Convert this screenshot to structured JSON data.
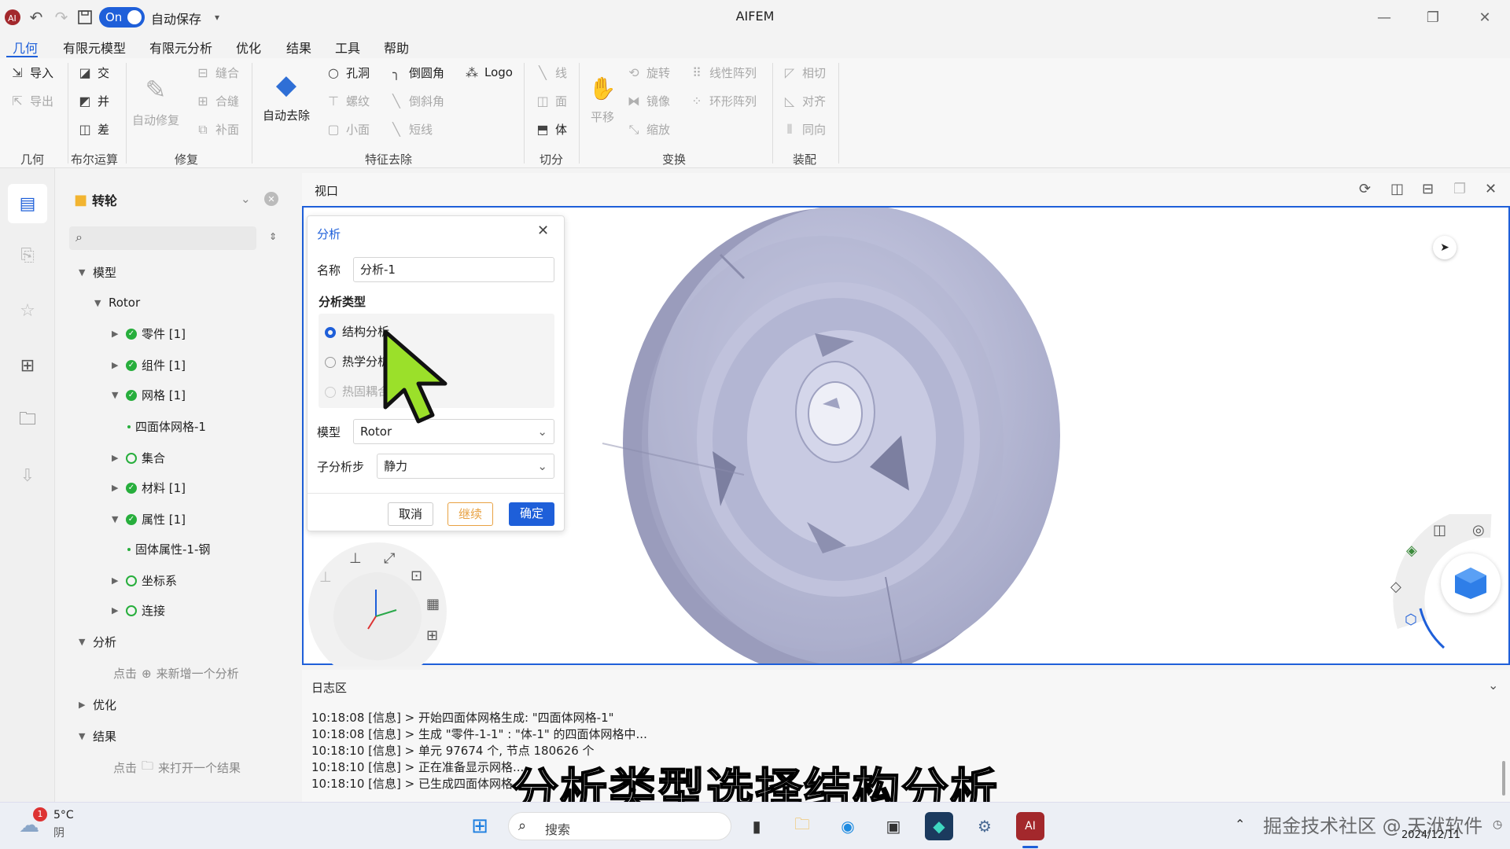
{
  "app": {
    "title": "AIFEM",
    "toggle_label": "On",
    "autosave_label": "自动保存"
  },
  "menu": [
    "几何",
    "有限元模型",
    "有限元分析",
    "优化",
    "结果",
    "工具",
    "帮助"
  ],
  "ribbon": {
    "geometry": {
      "import": "导入",
      "export": "导出",
      "label": "几何"
    },
    "boolean": {
      "intersect": "交",
      "union": "并",
      "subtract": "差",
      "label": "布尔运算"
    },
    "repair": {
      "auto_repair": "自动修复",
      "sew": "缝合",
      "merge_face": "合缝",
      "patch": "补面",
      "label": "修复"
    },
    "feature": {
      "auto_remove": "自动去除",
      "hole": "孔洞",
      "thread": "螺纹",
      "small_face": "小面",
      "fillet": "倒圆角",
      "chamfer": "倒斜角",
      "short_edge": "短线",
      "logo": "Logo",
      "label": "特征去除"
    },
    "split": {
      "line": "线",
      "face": "面",
      "body": "体",
      "label": "切分"
    },
    "transform": {
      "translate": "平移",
      "rotate": "旋转",
      "mirror": "镜像",
      "scale": "缩放",
      "linear_array": "线性阵列",
      "circular_array": "环形阵列",
      "label": "变换"
    },
    "assembly": {
      "tangent": "相切",
      "align": "对齐",
      "same_dir": "同向",
      "label": "装配"
    }
  },
  "tree": {
    "root": "转轮",
    "search_placeholder": "",
    "model": "模型",
    "rotor": "Rotor",
    "part": "零件 [1]",
    "component": "组件 [1]",
    "mesh": "网格 [1]",
    "tet_mesh": "四面体网格-1",
    "set": "集合",
    "material": "材料 [1]",
    "property": "属性 [1]",
    "solid_prop": "固体属性-1-钢",
    "csys": "坐标系",
    "connection": "连接",
    "analysis": "分析",
    "analysis_hint_pre": "点击",
    "analysis_hint_post": "来新增一个分析",
    "optimize": "优化",
    "result": "结果",
    "result_hint_pre": "点击",
    "result_hint_post": "来打开一个结果"
  },
  "viewport": {
    "title": "视口"
  },
  "dialog": {
    "title": "分析",
    "name_label": "名称",
    "name_value": "分析-1",
    "type_label": "分析类型",
    "type_structural": "结构分析",
    "type_thermal": "热学分析",
    "type_coupled": "热固耦合",
    "model_label": "模型",
    "model_value": "Rotor",
    "substep_label": "子分析步",
    "substep_value": "静力",
    "cancel": "取消",
    "continue": "继续",
    "ok": "确定"
  },
  "log": {
    "title": "日志区",
    "lines": [
      "10:18:08 [信息] > 开始四面体网格生成: \"四面体网格-1\"",
      "10:18:08 [信息] > 生成 \"零件-1-1\" : \"体-1\" 的四面体网格中...",
      "10:18:10 [信息] > 单元 97674 个, 节点 180626 个",
      "10:18:10 [信息] > 正在准备显示网格...",
      "10:18:10 [信息] > 已生成四面体网格"
    ]
  },
  "subtitle": "分析类型选择结构分析",
  "watermark": "掘金技术社区 @ 天洑软件",
  "taskbar": {
    "weather_temp": "5°C",
    "weather_desc": "阴",
    "weather_badge": "1",
    "search": "搜索",
    "date": "2024/12/11"
  },
  "colors": {
    "accent": "#1e5fd9",
    "ok_green": "#27ae3c",
    "continue_orange": "#e8a243",
    "model": "#b9bcd8"
  }
}
